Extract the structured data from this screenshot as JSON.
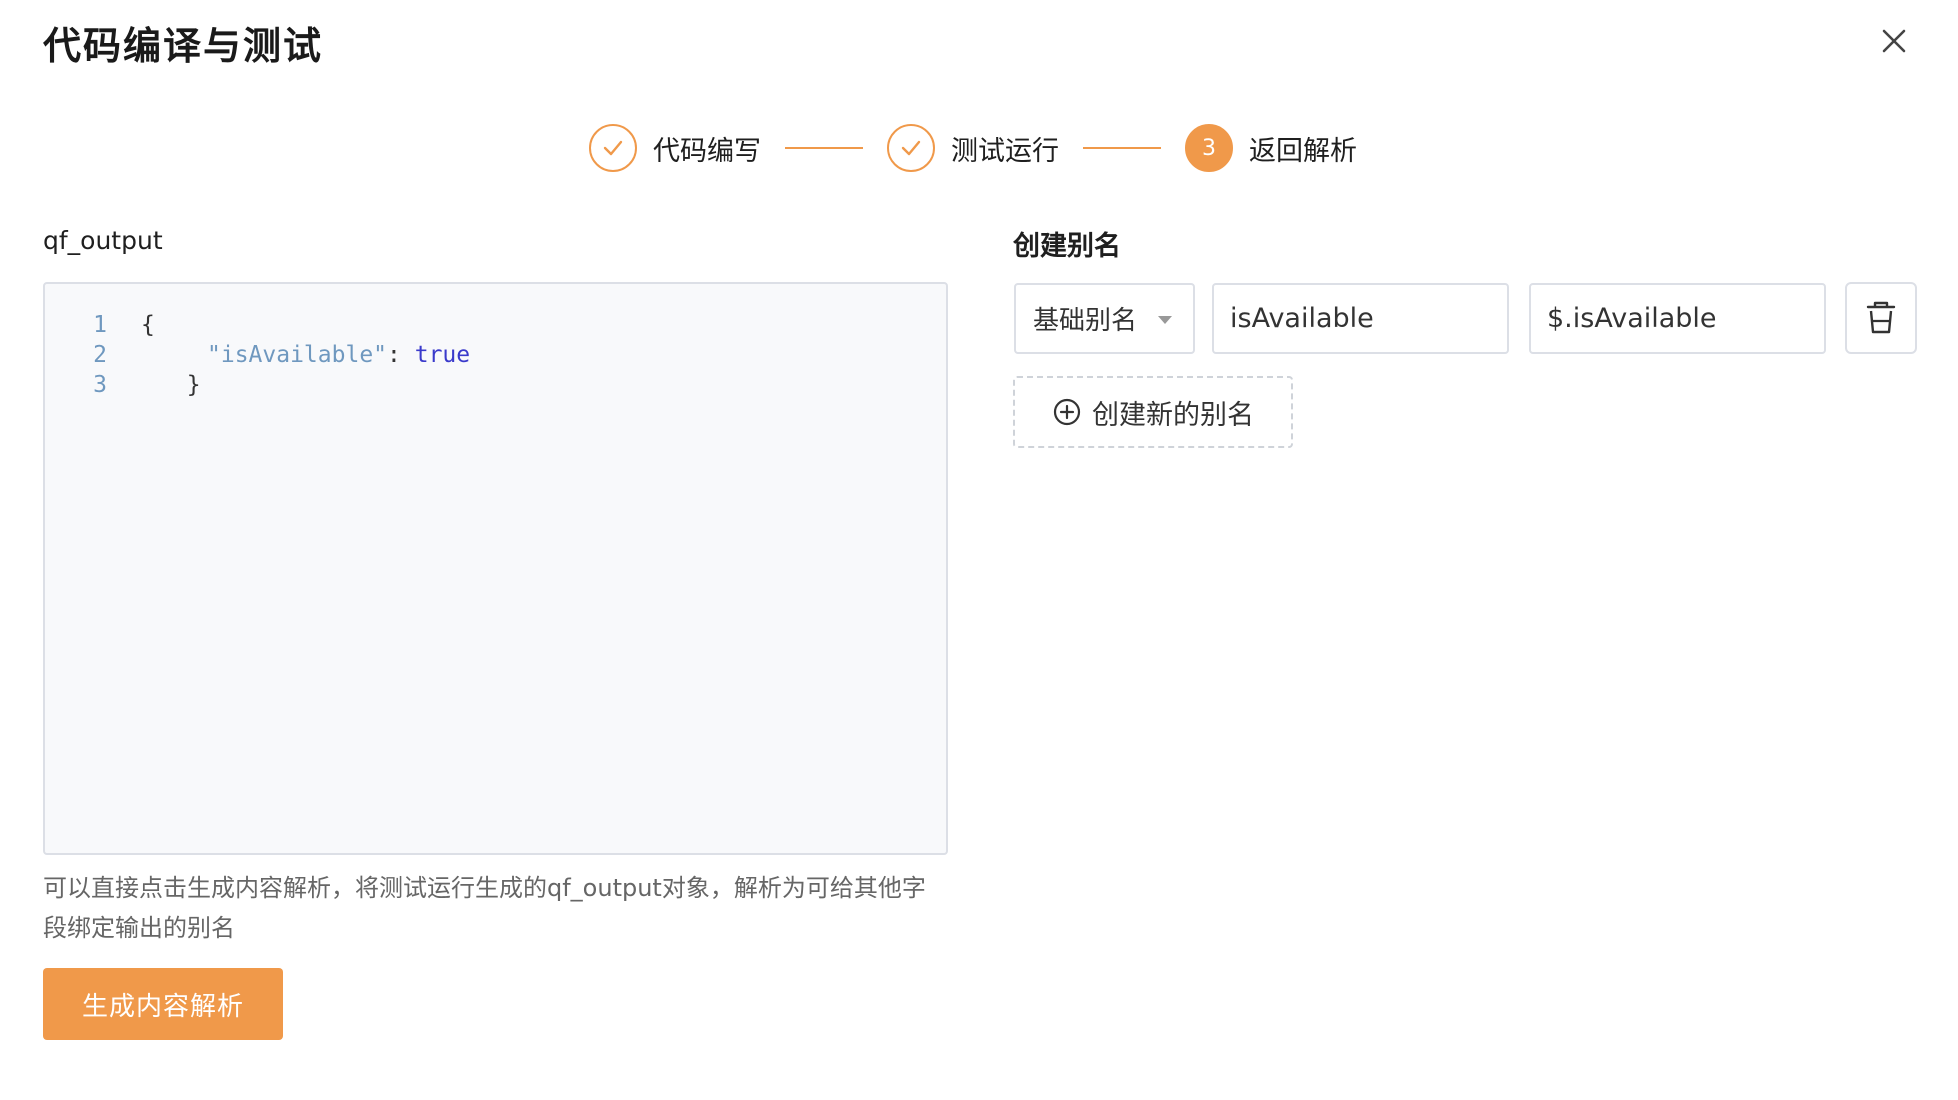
{
  "dialog": {
    "title": "代码编译与测试"
  },
  "steps": [
    {
      "label": "代码编写",
      "status": "done"
    },
    {
      "label": "测试运行",
      "status": "done"
    },
    {
      "label": "返回解析",
      "status": "active",
      "number": "3"
    }
  ],
  "output": {
    "label": "qf_output",
    "code_lines": [
      {
        "n": "1",
        "text": "{"
      },
      {
        "n": "2",
        "key": "\"isAvailable\"",
        "sep": ": ",
        "value": "true"
      },
      {
        "n": "3",
        "text": "  }"
      }
    ],
    "hint": "可以直接点击生成内容解析，将测试运行生成的qf_output对象，解析为可给其他字段绑定输出的别名",
    "generate_button": "生成内容解析"
  },
  "alias": {
    "title": "创建别名",
    "type_selected": "基础别名",
    "name_value": "isAvailable",
    "path_value": "$.isAvailable",
    "add_button": "创建新的别名"
  },
  "colors": {
    "accent": "#f0994a",
    "border": "#dcdfe6",
    "editor_bg": "#f8f9fb"
  }
}
